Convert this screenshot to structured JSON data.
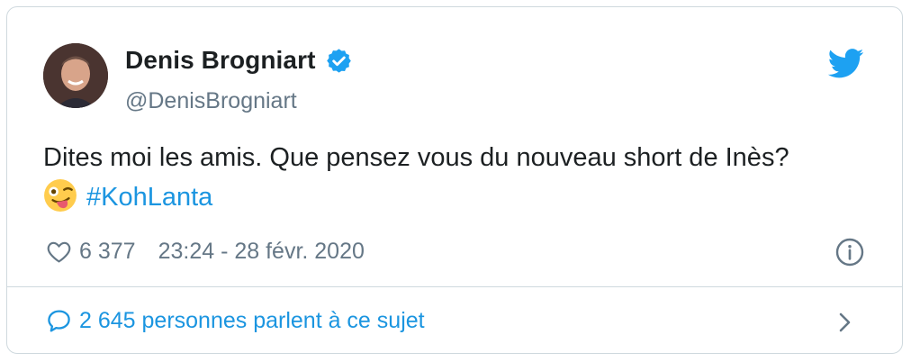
{
  "author": {
    "display_name": "Denis Brogniart",
    "handle": "@DenisBrogniart",
    "verified": true
  },
  "tweet": {
    "text": "Dites moi les amis. Que pensez vous du nouveau short de Inès?",
    "emoji": "winking-face-with-tongue",
    "hashtag": "#KohLanta"
  },
  "meta": {
    "likes": "6 377",
    "timestamp": "23:24 - 28 févr. 2020"
  },
  "footer": {
    "conversation_label": "2 645 personnes parlent à ce sujet"
  },
  "colors": {
    "accent": "#1b95e0",
    "secondary_text": "#657786",
    "border": "#cfd9de"
  }
}
